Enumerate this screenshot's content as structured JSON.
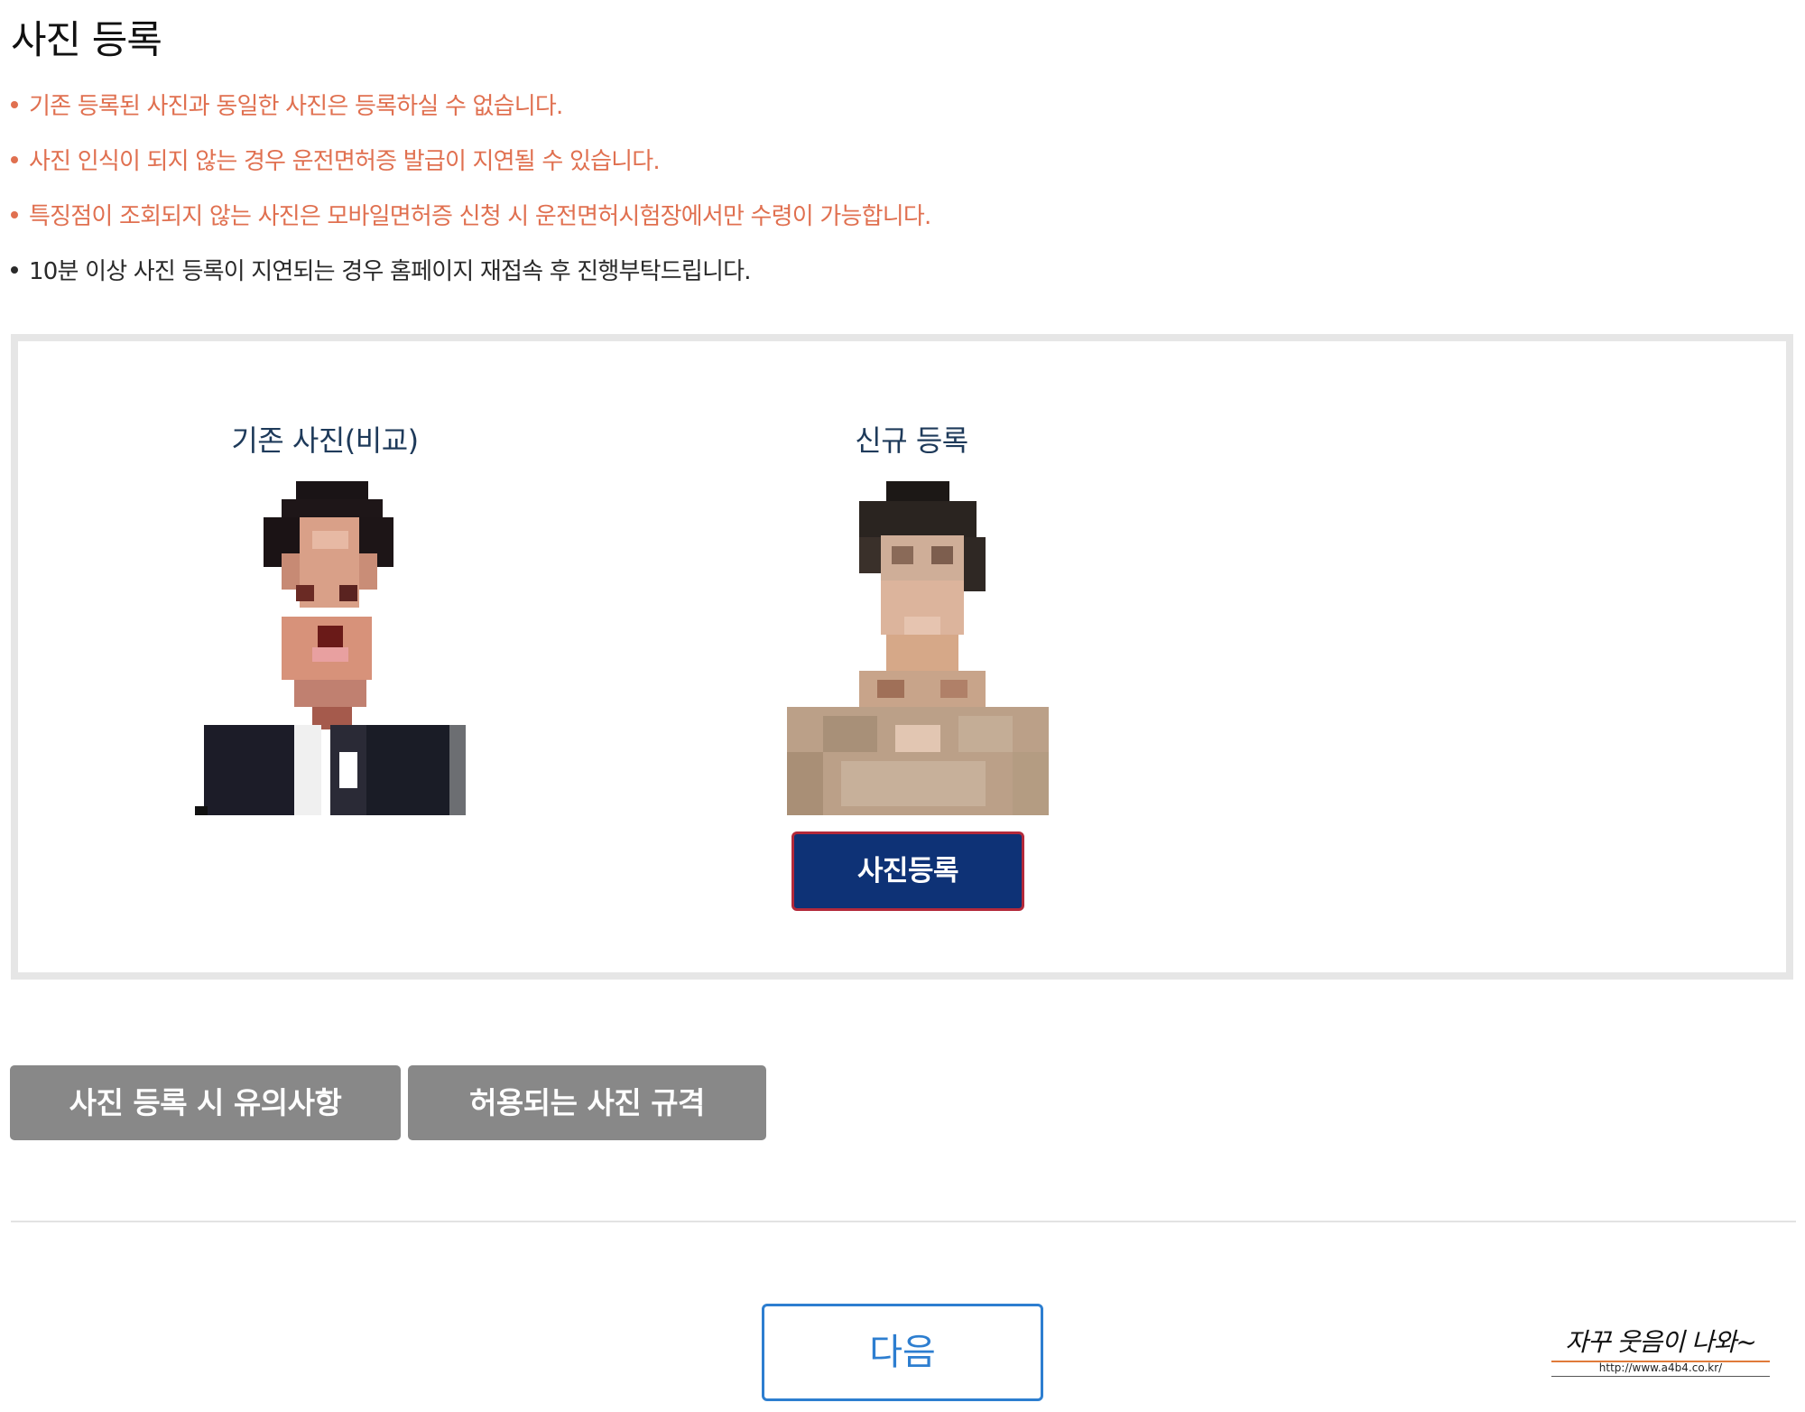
{
  "page": {
    "title": "사진 등록"
  },
  "notices": [
    {
      "text": "기존 등록된 사진과 동일한 사진은 등록하실 수 없습니다.",
      "type": "warning"
    },
    {
      "text": "사진 인식이 되지 않는 경우 운전면허증 발급이 지연될 수 있습니다.",
      "type": "warning"
    },
    {
      "text": "특징점이 조회되지 않는 사진은 모바일면허증 신청 시 운전면허시험장에서만 수령이 가능합니다.",
      "type": "warning"
    },
    {
      "text": "10분 이상 사진 등록이 지연되는 경우 홈페이지 재접속 후 진행부탁드립니다.",
      "type": "info"
    }
  ],
  "photo_panel": {
    "existing_title": "기존 사진(비교)",
    "new_title": "신규 등록",
    "register_label": "사진등록"
  },
  "buttons": {
    "caution_label": "사진 등록 시 유의사항",
    "spec_label": "허용되는 사진 규격",
    "next_label": "다음"
  },
  "watermark": {
    "text": "자꾸 웃음이 나와~",
    "url": "http://www.a4b4.co.kr/"
  },
  "colors": {
    "warning": "#e07050",
    "register_button": "#0e3276",
    "gray_button": "#888888",
    "next_button": "#2d7ed0",
    "title_text": "#1e3a5a"
  }
}
